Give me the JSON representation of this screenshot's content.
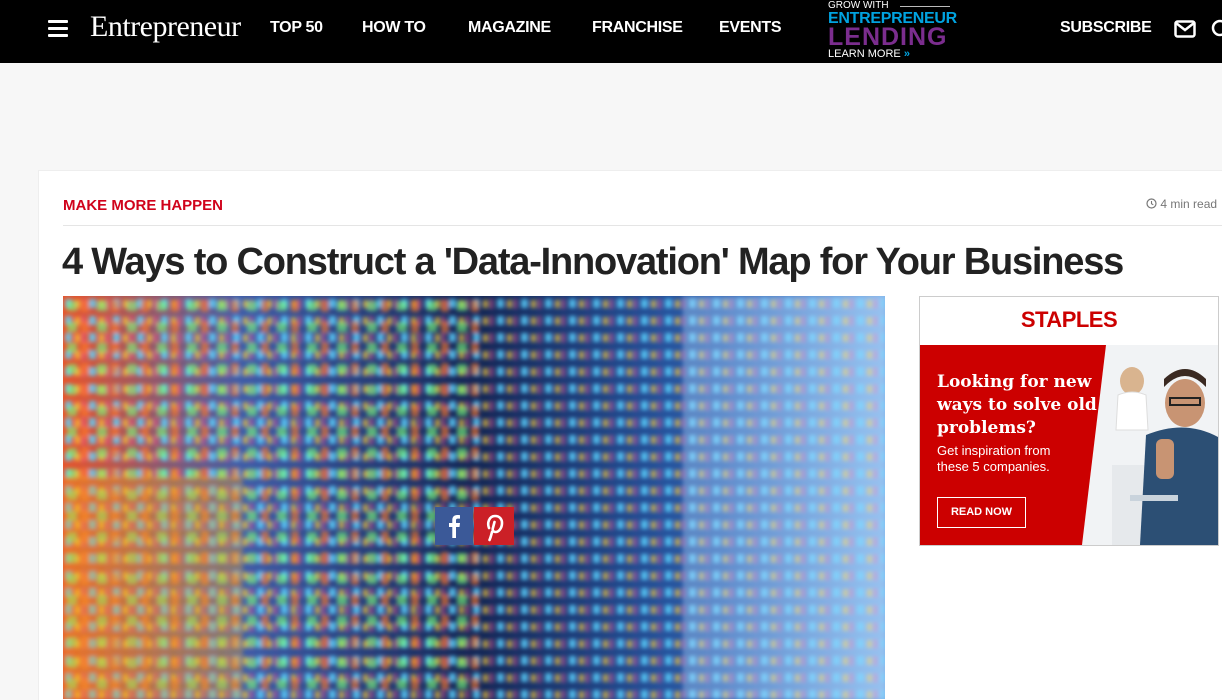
{
  "nav": {
    "logo": "Entrepreneur",
    "links": [
      "TOP 50",
      "HOW TO",
      "MAGAZINE",
      "FRANCHISE",
      "EVENTS"
    ],
    "promo": {
      "line1": "GROW WITH",
      "line2": "ENTREPRENEUR",
      "line3": "LENDING",
      "line4": "LEARN MORE",
      "arrow": "»"
    },
    "subscribe": "SUBSCRIBE",
    "icons": [
      "menu-icon",
      "mail-icon",
      "search-icon"
    ]
  },
  "article": {
    "kicker": "MAKE MORE HAPPEN",
    "read_time": "4 min read",
    "title": "4 Ways to Construct a 'Data-Innovation' Map for Your Business",
    "share": [
      "facebook-icon",
      "pinterest-icon"
    ]
  },
  "ad": {
    "brand": "STAPLES",
    "headline": "Looking for new ways to solve old problems?",
    "subtext": "Get inspiration from these 5 companies.",
    "button": "READ NOW"
  },
  "colors": {
    "accent": "#d0021b",
    "nav_bg": "#000000",
    "promo_blue": "#00a3e0",
    "promo_purple": "#7b2d8e",
    "ad_red": "#cc0000"
  }
}
